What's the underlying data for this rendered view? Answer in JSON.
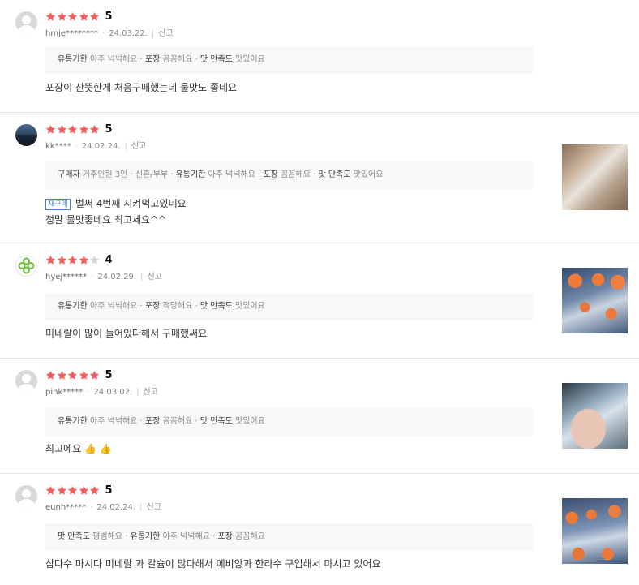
{
  "colors": {
    "star": "#f25c5c",
    "star_empty": "#d6d6d6",
    "rebuy": "#4a7fd4"
  },
  "reviews": [
    {
      "rating": 5,
      "score_label": "5",
      "user": "hmje********",
      "date": "24.03.22.",
      "report": "신고",
      "options": [
        {
          "k": "유통기한",
          "v": "아주 넉넉해요"
        },
        {
          "k": "포장",
          "v": "꼼꼼해요"
        },
        {
          "k": "맛 만족도",
          "v": "맛있어요"
        }
      ],
      "text_lines": [
        "포장이 산뜻한게 처음구매했는데 물맛도 좋네요"
      ],
      "rebuy": null,
      "photo": null
    },
    {
      "rating": 5,
      "score_label": "5",
      "user": "kk****",
      "date": "24.02.24.",
      "report": "신고",
      "options": [
        {
          "k": "구매자",
          "v": "거주인원 3인 · 신혼/부부"
        },
        {
          "k": "유통기한",
          "v": "아주 넉넉해요"
        },
        {
          "k": "포장",
          "v": "꼼꼼해요"
        },
        {
          "k": "맛 만족도",
          "v": "맛있어요"
        }
      ],
      "text_lines": [
        "벌써 4번째 시켜먹고있네요",
        "정말 물맛좋네요 최고세요^^"
      ],
      "rebuy": "재구매",
      "photo": "bottle-photo"
    },
    {
      "rating": 4,
      "score_label": "4",
      "user": "hyej******",
      "date": "24.02.29.",
      "report": "신고",
      "options": [
        {
          "k": "유통기한",
          "v": "아주 넉넉해요"
        },
        {
          "k": "포장",
          "v": "적당해요"
        },
        {
          "k": "맛 만족도",
          "v": "맛있어요"
        }
      ],
      "text_lines": [
        "미네랄이 많이 들어있다해서 구매했써요"
      ],
      "rebuy": null,
      "photo": "bottle-pack-photo"
    },
    {
      "rating": 5,
      "score_label": "5",
      "user": "pink*****",
      "date": "24.03.02.",
      "report": "신고",
      "options": [
        {
          "k": "유통기한",
          "v": "아주 넉넉해요"
        },
        {
          "k": "포장",
          "v": "꼼꼼해요"
        },
        {
          "k": "맛 만족도",
          "v": "맛있어요"
        }
      ],
      "text_lines": [
        "최고에요 👍 👍"
      ],
      "rebuy": null,
      "photo": "hand-bottle-photo"
    },
    {
      "rating": 5,
      "score_label": "5",
      "user": "eunh*****",
      "date": "24.02.24.",
      "report": "신고",
      "options": [
        {
          "k": "맛 만족도",
          "v": "평범해요"
        },
        {
          "k": "유통기한",
          "v": "아주 넉넉해요"
        },
        {
          "k": "포장",
          "v": "꼼꼼해요"
        }
      ],
      "text_lines": [
        "삼다수  마시다  미네랄 과  칼슘이  많다해서   에비앙과   한라수  구입해서  마시고  있어요"
      ],
      "rebuy": null,
      "photo": "bottle-pack-photo"
    }
  ]
}
